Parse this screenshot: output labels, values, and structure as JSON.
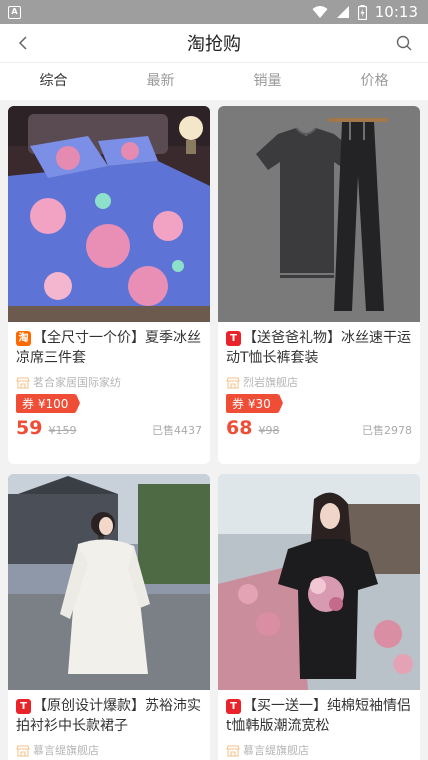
{
  "status": {
    "time": "10:13",
    "left_icon": "A"
  },
  "nav": {
    "title": "淘抢购"
  },
  "tabs": [
    {
      "label": "综合",
      "active": true
    },
    {
      "label": "最新",
      "active": false
    },
    {
      "label": "销量",
      "active": false
    },
    {
      "label": "价格",
      "active": false
    }
  ],
  "products": [
    {
      "source": "taobao",
      "badge": "淘",
      "title": "【全尺寸一个价】夏季冰丝凉席三件套",
      "shop": "茗合家居国际家纺",
      "coupon": "券 ¥100",
      "price": "59",
      "original_price": "¥159",
      "sold": "已售4437"
    },
    {
      "source": "tmall",
      "badge": "T",
      "title": "【送爸爸礼物】冰丝速干运动T恤长裤套装",
      "shop": "烈岩旗舰店",
      "coupon": "券 ¥30",
      "price": "68",
      "original_price": "¥98",
      "sold": "已售2978"
    },
    {
      "source": "tmall",
      "badge": "T",
      "title": "【原创设计爆款】苏裕沛实拍衬衫中长款裙子",
      "shop": "慕言缇旗舰店"
    },
    {
      "source": "tmall",
      "badge": "T",
      "title": "【买一送一】纯棉短袖情侣t恤韩版潮流宽松",
      "shop": "慕言缇旗舰店"
    }
  ]
}
